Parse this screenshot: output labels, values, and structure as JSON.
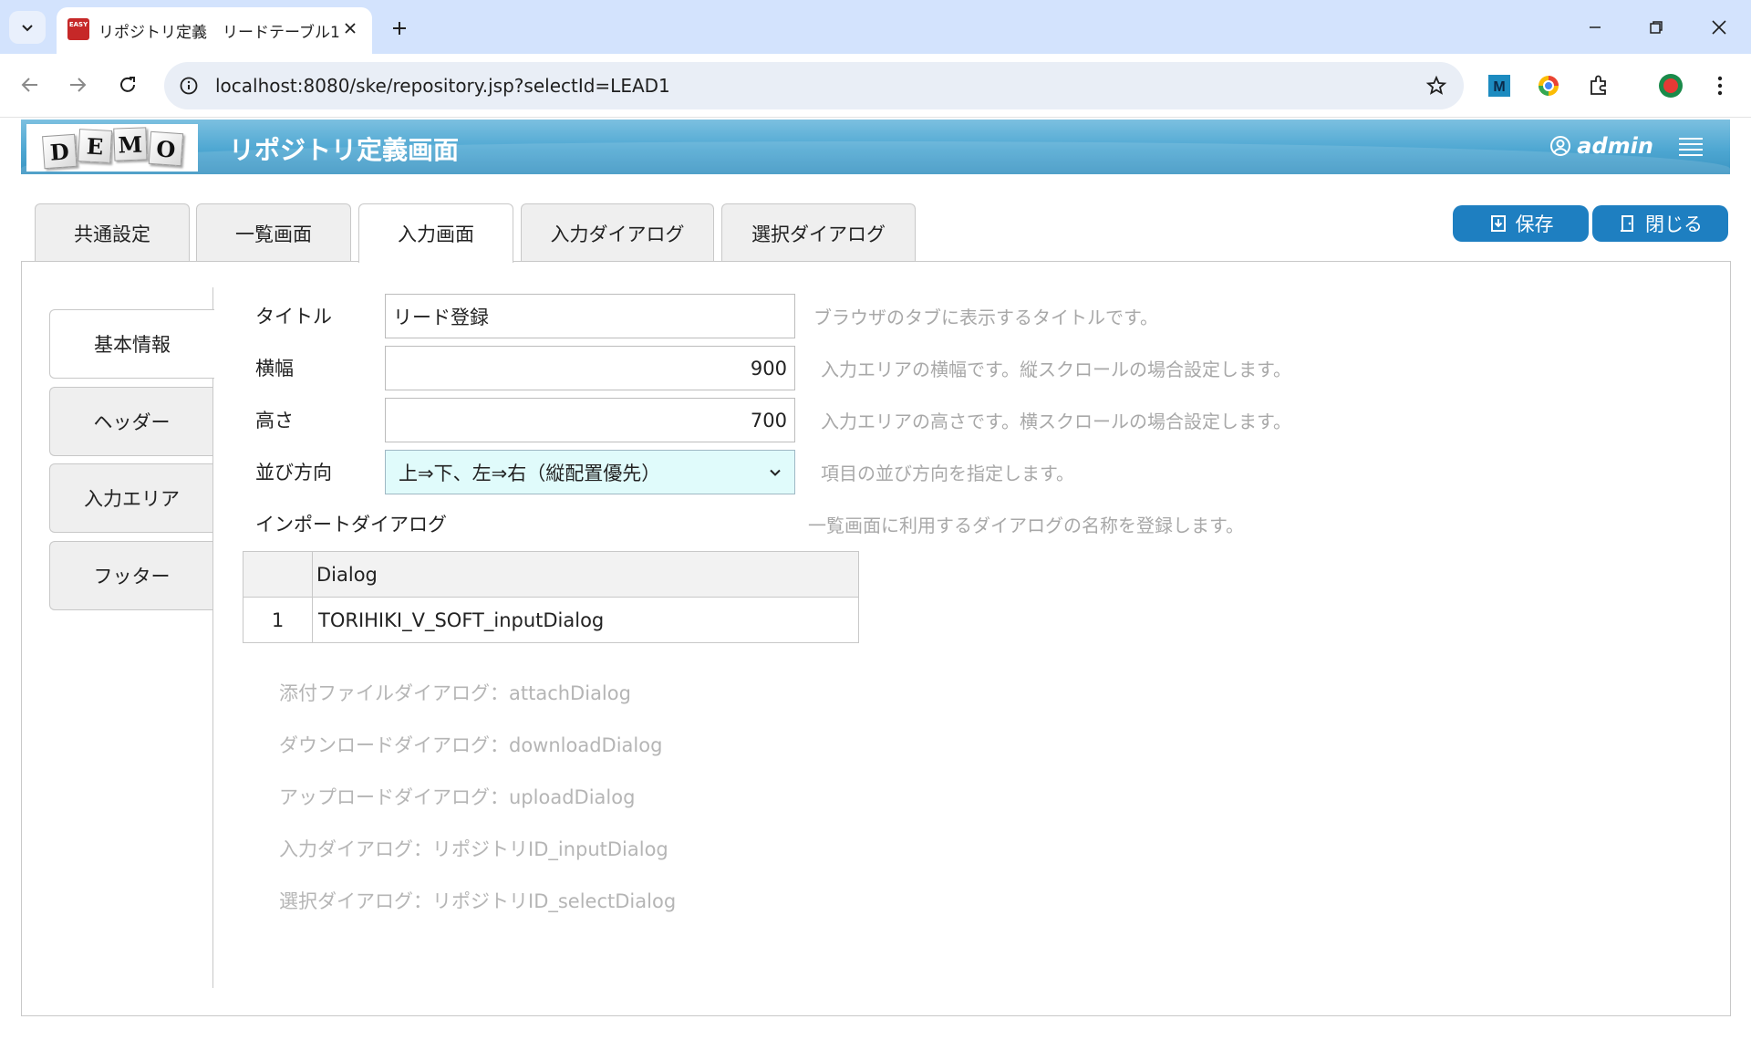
{
  "browser": {
    "tab_title": "リポジトリ定義　リードテーブル1",
    "favicon_text": "EASY",
    "url": "localhost:8080/ske/repository.jsp?selectId=LEAD1"
  },
  "app": {
    "logo_letters": [
      "D",
      "E",
      "M",
      "O"
    ],
    "title": "リポジトリ定義画面",
    "user": "admin"
  },
  "main_tabs": [
    {
      "label": "共通設定",
      "active": false
    },
    {
      "label": "一覧画面",
      "active": false
    },
    {
      "label": "入力画面",
      "active": true
    },
    {
      "label": "入力ダイアログ",
      "active": false
    },
    {
      "label": "選択ダイアログ",
      "active": false
    }
  ],
  "actions": {
    "save": "保存",
    "close": "閉じる"
  },
  "side_tabs": [
    {
      "label": "基本情報",
      "active": true
    },
    {
      "label": "ヘッダー",
      "active": false
    },
    {
      "label": "入力エリア",
      "active": false
    },
    {
      "label": "フッター",
      "active": false
    }
  ],
  "form": {
    "title": {
      "label": "タイトル",
      "value": "リード登録",
      "hint": "ブラウザのタブに表示するタイトルです。"
    },
    "width": {
      "label": "横幅",
      "value": "900",
      "hint": "入力エリアの横幅です。縦スクロールの場合設定します。"
    },
    "height": {
      "label": "高さ",
      "value": "700",
      "hint": "入力エリアの高さです。横スクロールの場合設定します。"
    },
    "direction": {
      "label": "並び方向",
      "value": "上⇒下、左⇒右（縦配置優先）",
      "hint": "項目の並び方向を指定します。"
    },
    "import_dialog": {
      "label": "インポートダイアログ",
      "hint": "一覧画面に利用するダイアログの名称を登録します。"
    }
  },
  "dialog_table": {
    "header": "Dialog",
    "rows": [
      {
        "index": "1",
        "value": "TORIHIKI_V_SOFT_inputDialog"
      }
    ]
  },
  "notes": [
    "添付ファイルダイアログ：attachDialog",
    "ダウンロードダイアログ：downloadDialog",
    "アップロードダイアログ：uploadDialog",
    "入力ダイアログ：リポジトリID_inputDialog",
    "選択ダイアログ：リポジトリID_selectDialog"
  ]
}
